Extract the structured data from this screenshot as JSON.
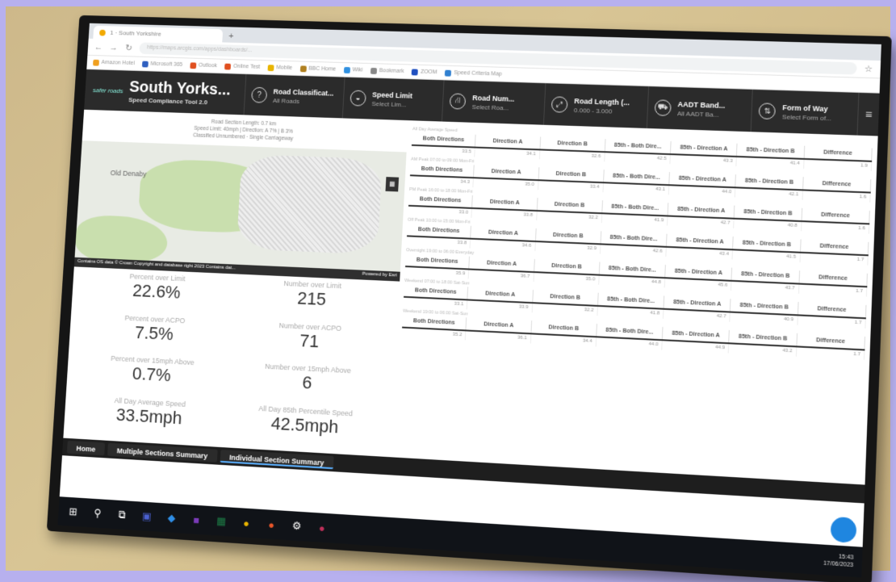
{
  "browser": {
    "tab_title": "1 · South Yorkshire",
    "new_tab": "+",
    "url": "https://maps.arcgis.com/apps/dashboards/...",
    "bookmarks": [
      "Amazon Hotel",
      "Microsoft 365",
      "Outlook",
      "Online Test",
      "Mobile",
      "BBC Home",
      "Wiki",
      "Bookmark",
      "ZOOM",
      "Speed Criteria Map"
    ]
  },
  "header": {
    "logo_text": "safer roads",
    "title": "South Yorks...",
    "subtitle": "Speed Compliance Tool 2.0",
    "filters": [
      {
        "icon": "?",
        "icon_name": "help-circle-icon",
        "label": "Road Classificat...",
        "value": "All Roads"
      },
      {
        "icon": "◒",
        "icon_name": "speedometer-icon",
        "label": "Speed Limit",
        "value": "Select Lim..."
      },
      {
        "icon": "⛙",
        "icon_name": "road-icon",
        "label": "Road Num...",
        "value": "Select Roa..."
      },
      {
        "icon": "⤢",
        "icon_name": "resize-icon",
        "label": "Road Length (...",
        "value": "0.000 - 3.000"
      },
      {
        "icon": "⛟",
        "icon_name": "truck-icon",
        "label": "AADT Band...",
        "value": "All AADT Ba..."
      },
      {
        "icon": "⇅",
        "icon_name": "sort-icon",
        "label": "Form of Way",
        "value": "Select Form of..."
      }
    ],
    "menu_icon": "≡"
  },
  "map": {
    "caption": [
      "Road Section Length: 0.7 km",
      "Speed Limit: 40mph | Direction: A 7% | B 3%",
      "Classified Unnumbered · Single Carriageway"
    ],
    "place_label": "Old Denaby",
    "button_icon": "▦",
    "attribution": "Contains OS data © Crown Copyright and database right 2023 Contains dat...",
    "powered_by": "Powered by Esri"
  },
  "stats": [
    {
      "label": "Percent over Limit",
      "value": "22.6%"
    },
    {
      "label": "Number over Limit",
      "value": "215"
    },
    {
      "label": "Percent over ACPO",
      "value": "7.5%"
    },
    {
      "label": "Number over ACPO",
      "value": "71"
    },
    {
      "label": "Percent over 15mph Above",
      "value": "0.7%"
    },
    {
      "label": "Number over 15mph Above",
      "value": "6"
    },
    {
      "label": "All Day Average Speed",
      "value": "33.5mph"
    },
    {
      "label": "All Day 85th Percentile Speed",
      "value": "42.5mph"
    }
  ],
  "table": {
    "columns": [
      "Both Directions",
      "Direction A",
      "Direction B",
      "85th - Both Dire...",
      "85th - Direction A",
      "85th - Direction B",
      "Difference"
    ],
    "blocks": [
      {
        "title": "All Day Average Speed",
        "values": [
          "33.5",
          "34.1",
          "32.6",
          "42.5",
          "43.3",
          "41.4",
          "1.9"
        ]
      },
      {
        "title": "AM Peak 07:00 to 09:00 Mon-Fri",
        "values": [
          "34.3",
          "35.0",
          "33.4",
          "43.1",
          "44.0",
          "42.1",
          "1.6"
        ]
      },
      {
        "title": "PM Peak 16:00 to 18:00 Mon-Fri",
        "values": [
          "33.0",
          "33.8",
          "32.2",
          "41.9",
          "42.7",
          "40.8",
          "1.6"
        ]
      },
      {
        "title": "Off Peak 10:00 to 15:00 Mon-Fri",
        "values": [
          "33.8",
          "34.6",
          "32.9",
          "42.6",
          "43.4",
          "41.5",
          "1.7"
        ]
      },
      {
        "title": "Overnight 19:00 to 06:00 Everyday",
        "values": [
          "35.9",
          "36.7",
          "35.0",
          "44.8",
          "45.6",
          "43.7",
          "1.7"
        ]
      },
      {
        "title": "Weekend 07:00 to 18:00 Sat-Sun",
        "values": [
          "33.1",
          "33.9",
          "32.2",
          "41.8",
          "42.7",
          "40.9",
          "1.7"
        ]
      },
      {
        "title": "Weekend 19:00 to 06:00 Sat-Sun",
        "values": [
          "35.2",
          "36.1",
          "34.4",
          "44.0",
          "44.9",
          "43.2",
          "1.7"
        ]
      }
    ]
  },
  "nav_tabs": [
    "Home",
    "Multiple Sections Summary",
    "Individual Section Summary"
  ],
  "taskbar": {
    "icons": [
      {
        "glyph": "⊞",
        "name": "windows-start-icon",
        "color": "#ffffff"
      },
      {
        "glyph": "⚲",
        "name": "search-icon",
        "color": "#ffffff"
      },
      {
        "glyph": "⧉",
        "name": "task-view-icon",
        "color": "#ffffff"
      },
      {
        "glyph": "▣",
        "name": "teams-icon",
        "color": "#4b61d1"
      },
      {
        "glyph": "◆",
        "name": "edge-icon",
        "color": "#2f8ee6"
      },
      {
        "glyph": "■",
        "name": "onenote-icon",
        "color": "#7a3bb8"
      },
      {
        "glyph": "▦",
        "name": "excel-icon",
        "color": "#1d7a45"
      },
      {
        "glyph": "●",
        "name": "chrome-icon",
        "color": "#e8b400"
      },
      {
        "glyph": "●",
        "name": "firefox-icon",
        "color": "#e8562a"
      },
      {
        "glyph": "⚙",
        "name": "settings-icon",
        "color": "#ffffff"
      },
      {
        "glyph": "●",
        "name": "app-icon",
        "color": "#c0305a"
      }
    ],
    "time": "15:43",
    "date": "17/06/2023"
  }
}
